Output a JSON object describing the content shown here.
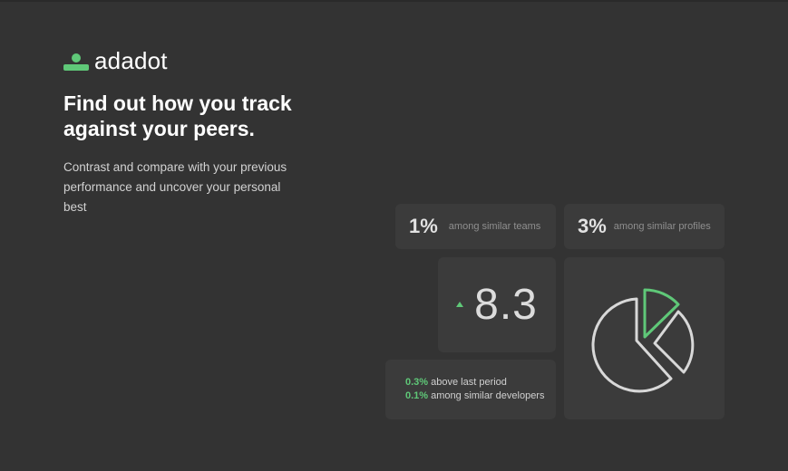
{
  "brand": {
    "name": "adadot"
  },
  "hero": {
    "headline": "Find out how you track against your peers.",
    "subtext": "Contrast and compare with your previous performance and uncover your personal best"
  },
  "stats": {
    "teams": {
      "value": "1%",
      "label": "among similar teams"
    },
    "profiles": {
      "value": "3%",
      "label": "among similar profiles"
    }
  },
  "score": {
    "value": "8.3",
    "trend": "up"
  },
  "comparison": [
    {
      "value": "0.3%",
      "text": " above last period"
    },
    {
      "value": "0.1%",
      "text": " among similar developers"
    }
  ],
  "colors": {
    "background": "#333333",
    "card": "#3b3b3b",
    "accent": "#5fc878",
    "text_muted": "#8f8f8f"
  },
  "icons": {
    "logo": "adadot-logo-icon",
    "trend": "trend-up-icon",
    "chart": "pie-chart-icon"
  }
}
